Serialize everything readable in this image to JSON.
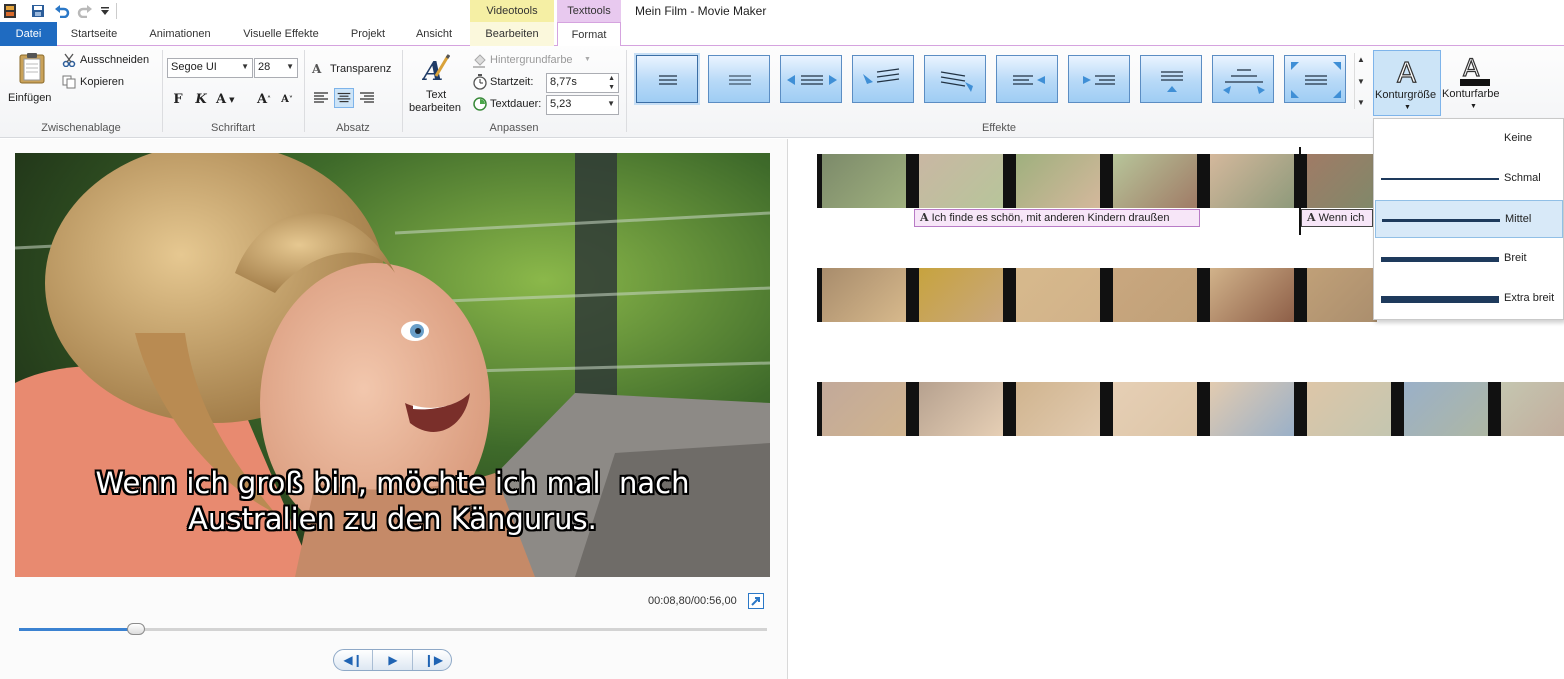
{
  "window": {
    "title": "Mein Film - Movie Maker"
  },
  "contextual_tabs": {
    "video": "Videotools",
    "text": "Texttools"
  },
  "tabs": [
    "Datei",
    "Startseite",
    "Animationen",
    "Visuelle Effekte",
    "Projekt",
    "Ansicht",
    "Bearbeiten",
    "Format"
  ],
  "active_tab": "Format",
  "ribbon": {
    "clipboard": {
      "paste": "Einfügen",
      "cut": "Ausschneiden",
      "copy": "Kopieren",
      "label": "Zwischenablage"
    },
    "font": {
      "family": "Segoe UI",
      "size": "28",
      "bold": "F",
      "italic": "K",
      "color": "A",
      "grow": "A",
      "shrink": "A",
      "label": "Schriftart"
    },
    "paragraph": {
      "transparency": "Transparenz",
      "label": "Absatz"
    },
    "adjust": {
      "edit_text_line1": "Text",
      "edit_text_line2": "bearbeiten",
      "background_color": "Hintergrundfarbe",
      "start_label": "Startzeit:",
      "start_value": "8,77s",
      "duration_label": "Textdauer:",
      "duration_value": "5,23",
      "label": "Anpassen"
    },
    "effects": {
      "label": "Effekte",
      "count": 10,
      "selected_index": 0
    },
    "outline_size": {
      "label": "Konturgröße"
    },
    "outline_color": {
      "label": "Konturfarbe"
    }
  },
  "preview": {
    "caption_line1": "Wenn ich groß bin, möchte ich mal  nach",
    "caption_line2": "Australien zu den Kängurus.",
    "timecode": "00:08,80/00:56,00",
    "progress_fraction": 0.157
  },
  "storyboard": {
    "caption1": "Ich finde es schön, mit anderen Kindern draußen",
    "caption2": "Wenn ich",
    "caption_icon": "A"
  },
  "outline_dropdown": {
    "items": [
      {
        "label": "Keine",
        "weight": 0
      },
      {
        "label": "Schmal",
        "weight": 2
      },
      {
        "label": "Mittel",
        "weight": 3
      },
      {
        "label": "Breit",
        "weight": 5
      },
      {
        "label": "Extra breit",
        "weight": 7
      }
    ],
    "selected": "Mittel"
  },
  "colors": {
    "accent": "#1f6bc1",
    "context_video": "#f5efa4",
    "context_text": "#e8c9ef",
    "selected_item": "#d8e9f8"
  }
}
